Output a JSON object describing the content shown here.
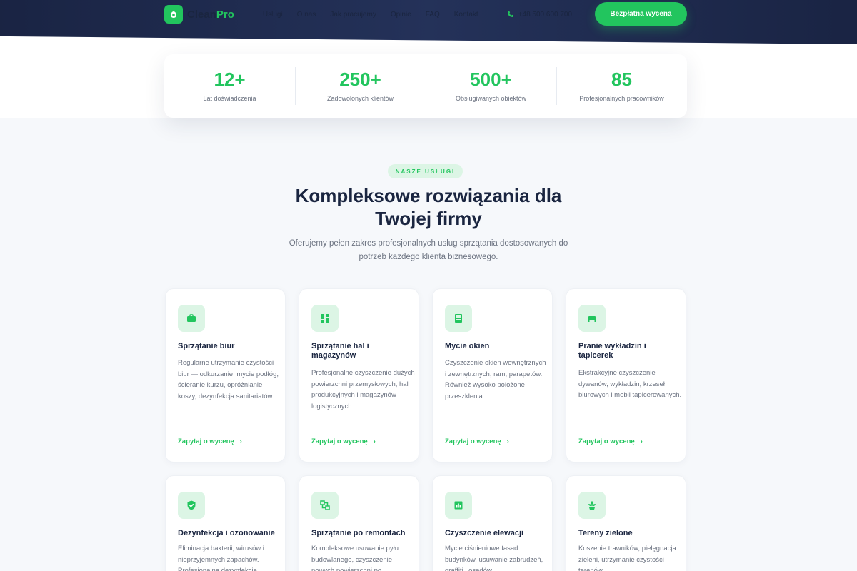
{
  "brand": {
    "name_part1": "Clean",
    "name_part2": "Pro"
  },
  "nav": {
    "links": [
      "Usługi",
      "O nas",
      "Jak pracujemy",
      "Opinie",
      "FAQ",
      "Kontakt"
    ],
    "phone": "+48 500 600 700",
    "cta": "Bezpłatna wycena"
  },
  "stats": [
    {
      "value": "12+",
      "label": "Lat doświadczenia"
    },
    {
      "value": "250+",
      "label": "Zadowolonych klientów"
    },
    {
      "value": "500+",
      "label": "Obsługiwanych obiektów"
    },
    {
      "value": "85",
      "label": "Profesjonalnych pracowników"
    }
  ],
  "section": {
    "badge": "NASZE USŁUGI",
    "title_line1": "Kompleksowe rozwiązania dla",
    "title_line2": "Twojej firmy",
    "subtitle": "Oferujemy pełen zakres profesjonalnych usług sprzątania dostosowanych do potrzeb każdego klienta biznesowego."
  },
  "services": [
    {
      "icon": "briefcase-icon",
      "title": "Sprzątanie biur",
      "desc": "Regularne utrzymanie czystości biur — odkurzanie, mycie podłóg, ścieranie kurzu, opróżnianie koszy, dezynfekcja sanitariatów.",
      "link": "Zapytaj o wycenę"
    },
    {
      "icon": "warehouse-icon",
      "title": "Sprzątanie hal i magazynów",
      "desc": "Profesjonalne czyszczenie dużych powierzchni przemysłowych, hal produkcyjnych i magazynów logistycznych.",
      "link": "Zapytaj o wycenę"
    },
    {
      "icon": "window-icon",
      "title": "Mycie okien",
      "desc": "Czyszczenie okien wewnętrznych i zewnętrznych, ram, parapetów. Również wysoko położone przeszklenia.",
      "link": "Zapytaj o wycenę"
    },
    {
      "icon": "sofa-icon",
      "title": "Pranie wykładzin i tapicerek",
      "desc": "Ekstrakcyjne czyszczenie dywanów, wykładzin, krzeseł biurowych i mebli tapicerowanych.",
      "link": "Zapytaj o wycenę"
    },
    {
      "icon": "shield-check-icon",
      "title": "Dezynfekcja i ozonowanie",
      "desc": "Eliminacja bakterii, wirusów i nieprzyjemnych zapachów. Profesjonalna dezynfekcja",
      "link": ""
    },
    {
      "icon": "tools-icon",
      "title": "Sprzątanie po remontach",
      "desc": "Kompleksowe usuwanie pyłu budowlanego, czyszczenie nowych powierzchni po",
      "link": ""
    },
    {
      "icon": "building-icon",
      "title": "Czyszczenie elewacji",
      "desc": "Mycie ciśnieniowe fasad budynków, usuwanie zabrudzeń, graffiti i osadów",
      "link": ""
    },
    {
      "icon": "plant-icon",
      "title": "Tereny zielone",
      "desc": "Koszenie trawników, pielęgnacja zieleni, utrzymanie czystości terenów",
      "link": ""
    }
  ],
  "colors": {
    "accent": "#22c55e",
    "navy": "#1a2540"
  }
}
